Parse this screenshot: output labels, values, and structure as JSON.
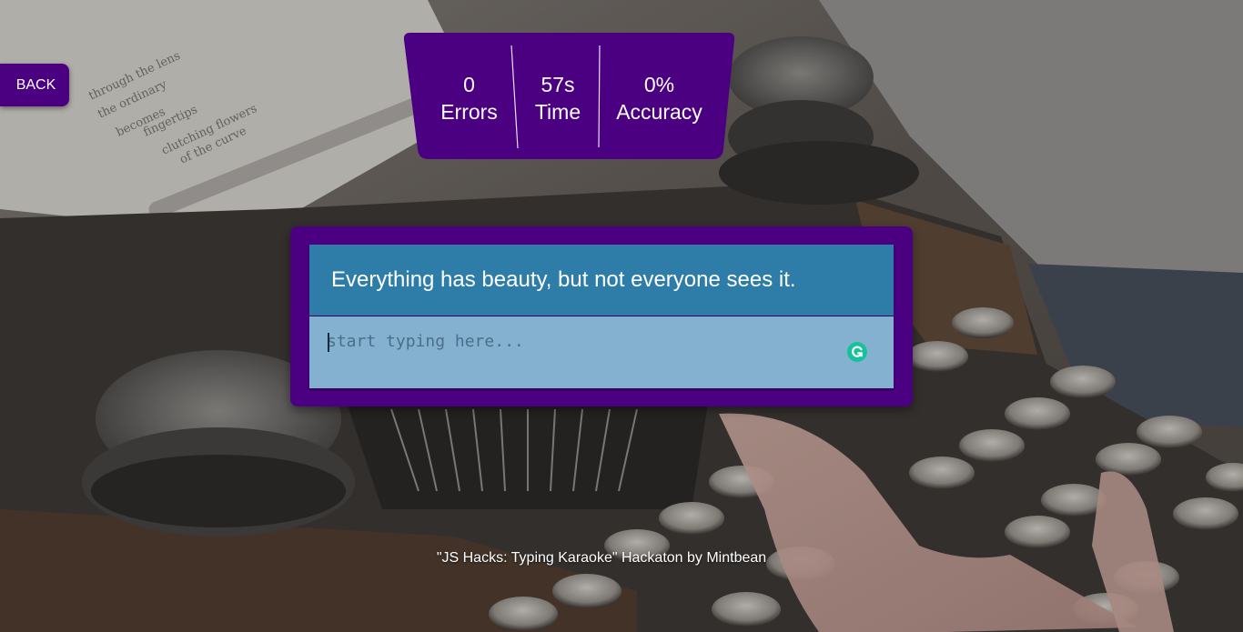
{
  "navigation": {
    "back_label": "BACK"
  },
  "stats": {
    "errors_value": "0",
    "errors_label": "Errors",
    "time_value": "57s",
    "time_label": "Time",
    "accuracy_value": "0%",
    "accuracy_label": "Accuracy"
  },
  "quote": {
    "text": "Everything has beauty, but not everyone sees it."
  },
  "typing": {
    "placeholder": "start typing here...",
    "value": ""
  },
  "footer": {
    "credit": "\"JS Hacks: Typing Karaoke\" Hackaton by Mintbean"
  },
  "icons": {
    "grammarly": "grammarly-g-icon"
  },
  "colors": {
    "accent": "#4b0082",
    "quote_bg": "#2e7ca8",
    "input_bg": "#84b1d0",
    "grammarly": "#15c39a",
    "text": "#ffffff"
  }
}
